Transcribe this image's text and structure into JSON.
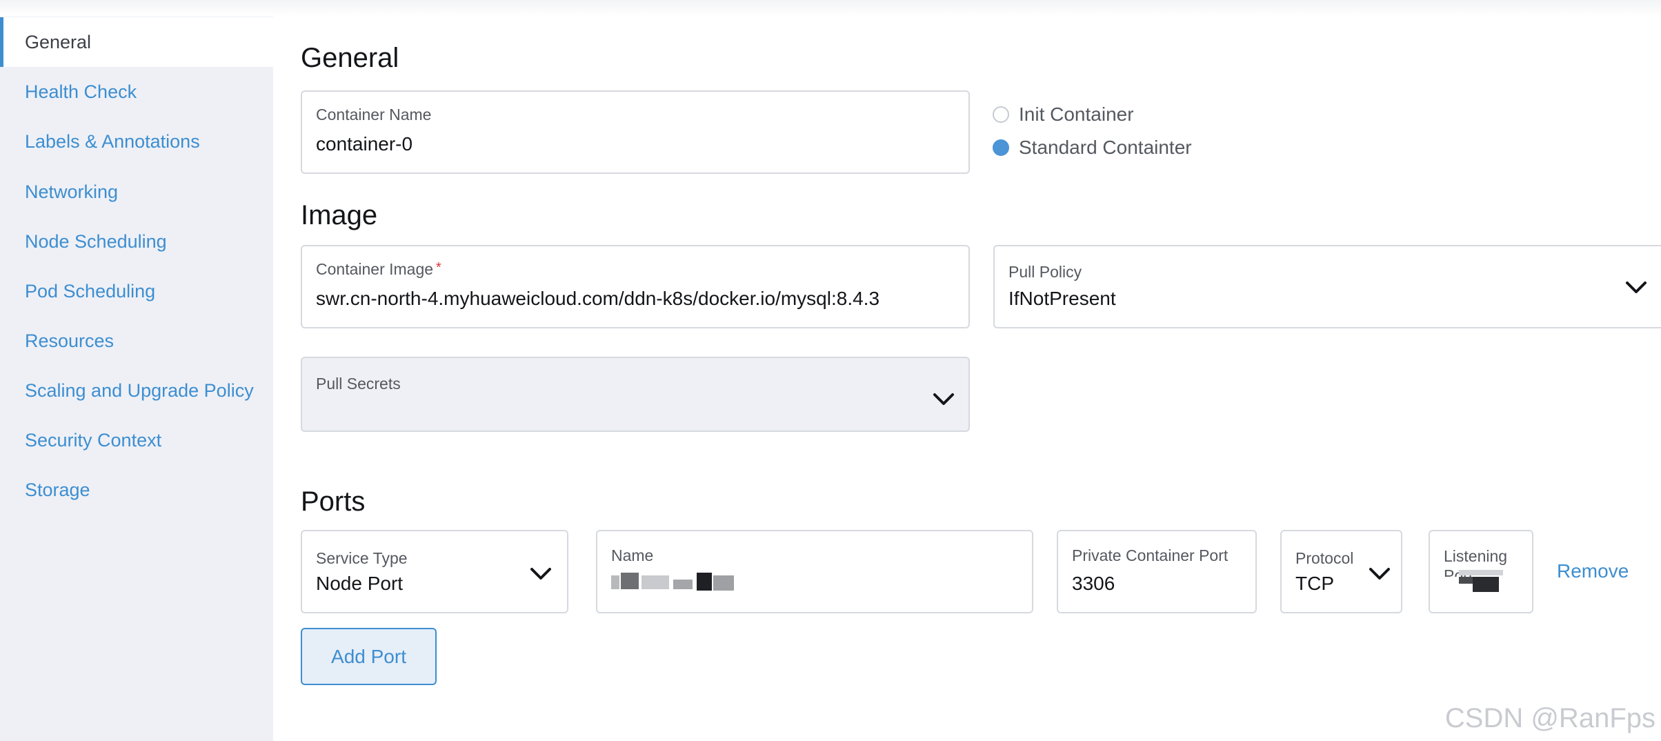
{
  "sidebar": {
    "items": [
      {
        "label": "General",
        "active": true
      },
      {
        "label": "Health Check",
        "active": false
      },
      {
        "label": "Labels & Annotations",
        "active": false
      },
      {
        "label": "Networking",
        "active": false
      },
      {
        "label": "Node Scheduling",
        "active": false
      },
      {
        "label": "Pod Scheduling",
        "active": false
      },
      {
        "label": "Resources",
        "active": false
      },
      {
        "label": "Scaling and Upgrade Policy",
        "active": false
      },
      {
        "label": "Security Context",
        "active": false
      },
      {
        "label": "Storage",
        "active": false
      }
    ]
  },
  "general": {
    "title": "General",
    "container_name": {
      "label": "Container Name",
      "value": "container-0"
    },
    "container_type": {
      "options": [
        "Init Container",
        "Standard Containter"
      ],
      "selected": "Standard Containter"
    }
  },
  "image": {
    "title": "Image",
    "container_image": {
      "label": "Container Image",
      "required_mark": "*",
      "value": "swr.cn-north-4.myhuaweicloud.com/ddn-k8s/docker.io/mysql:8.4.3"
    },
    "pull_policy": {
      "label": "Pull Policy",
      "value": "IfNotPresent"
    },
    "pull_secrets": {
      "label": "Pull Secrets",
      "value": ""
    }
  },
  "ports": {
    "title": "Ports",
    "rows": [
      {
        "service_type": {
          "label": "Service Type",
          "value": "Node Port"
        },
        "name": {
          "label": "Name",
          "value": "",
          "redacted": true
        },
        "private_port": {
          "label": "Private Container Port",
          "value": "3306"
        },
        "protocol": {
          "label": "Protocol",
          "value": "TCP"
        },
        "listening_port": {
          "label": "Listening Port",
          "value": "",
          "redacted": true
        },
        "remove_label": "Remove"
      }
    ],
    "add_label": "Add Port"
  },
  "icons": {
    "dropdown": "chevron-down-icon"
  },
  "colors": {
    "accent": "#3d8ed0",
    "sidebar_bg": "#eef0f6",
    "required": "#d9363e",
    "radio_checked": "#4b94d6"
  },
  "watermark": "CSDN @RanFps"
}
